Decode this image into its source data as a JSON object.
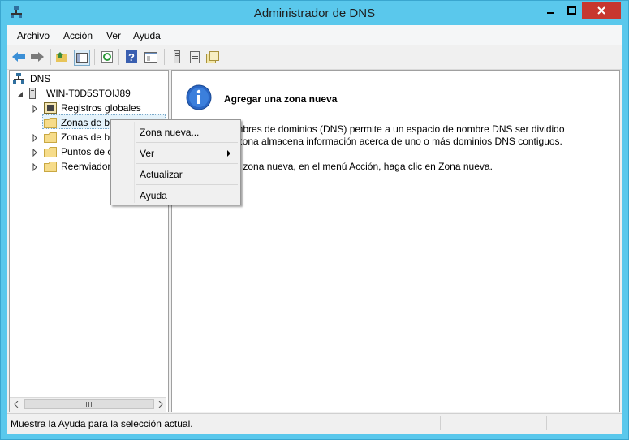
{
  "window": {
    "title": "Administrador de DNS",
    "accent": "#5ac8ec"
  },
  "menubar": [
    "Archivo",
    "Acción",
    "Ver",
    "Ayuda"
  ],
  "toolbar": {
    "icons": [
      "back-icon",
      "forward-icon",
      "up-folder-icon",
      "show-hide-tree-icon",
      "refresh-icon",
      "help-icon",
      "properties-panel-icon",
      "server-icon",
      "list-icon",
      "zones-icon"
    ]
  },
  "tree": {
    "root": "DNS",
    "server": "WIN-T0D5STOIJ89",
    "children": [
      {
        "label": "Registros globales",
        "icon": "global-records-icon"
      },
      {
        "label": "Zonas de bú",
        "icon": "folder-icon"
      },
      {
        "label": "Zonas de bú",
        "icon": "folder-icon"
      },
      {
        "label": "Puntos de c",
        "icon": "folder-icon"
      },
      {
        "label": "Reenviadore",
        "icon": "folder-icon"
      }
    ]
  },
  "details": {
    "heading": "Agregar una zona nueva",
    "p1_line1": "nombres de dominios (DNS) permite a un espacio de nombre DNS ser dividido",
    "p1_line2": "da zona almacena información acerca de uno o más dominios DNS contiguos.",
    "p2": "una zona nueva, en el menú Acción, haga clic en Zona nueva."
  },
  "context_menu": {
    "items": [
      "Zona nueva...",
      "Ver",
      "Actualizar",
      "Ayuda"
    ]
  },
  "status": "Muestra la Ayuda para la selección actual."
}
